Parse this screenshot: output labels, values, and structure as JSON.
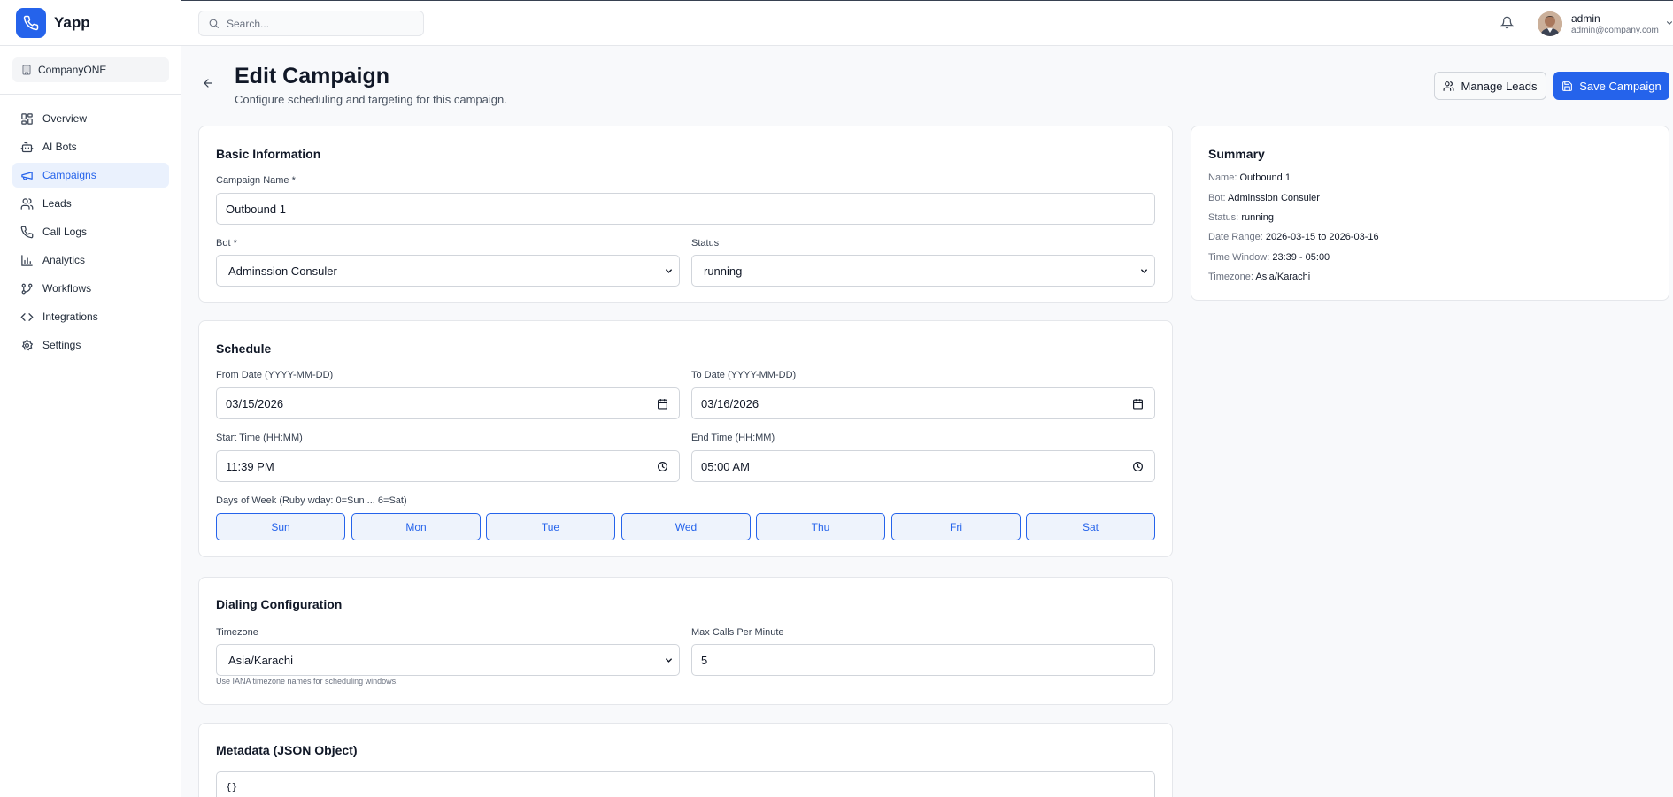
{
  "brand": {
    "name": "Yapp"
  },
  "company": {
    "name": "CompanyONE"
  },
  "nav": [
    {
      "label": "Overview",
      "icon": "grid-icon"
    },
    {
      "label": "AI Bots",
      "icon": "bot-icon"
    },
    {
      "label": "Campaigns",
      "icon": "megaphone-icon",
      "active": true
    },
    {
      "label": "Leads",
      "icon": "users-icon"
    },
    {
      "label": "Call Logs",
      "icon": "phone-icon"
    },
    {
      "label": "Analytics",
      "icon": "bar-chart-icon"
    },
    {
      "label": "Workflows",
      "icon": "workflow-icon"
    },
    {
      "label": "Integrations",
      "icon": "code-icon"
    },
    {
      "label": "Settings",
      "icon": "gear-icon"
    }
  ],
  "search": {
    "placeholder": "Search..."
  },
  "user": {
    "name": "admin",
    "email": "admin@company.com"
  },
  "header": {
    "title": "Edit Campaign",
    "subtitle": "Configure scheduling and targeting for this campaign.",
    "manage_leads_label": "Manage Leads",
    "save_label": "Save Campaign"
  },
  "basic": {
    "title": "Basic Information",
    "name_label": "Campaign Name *",
    "name_value": "Outbound 1",
    "bot_label": "Bot *",
    "bot_value": "Adminssion Consuler",
    "status_label": "Status",
    "status_value": "running"
  },
  "schedule": {
    "title": "Schedule",
    "from_label": "From Date (YYYY-MM-DD)",
    "from_value": "03/15/2026",
    "to_label": "To Date (YYYY-MM-DD)",
    "to_value": "03/16/2026",
    "start_label": "Start Time (HH:MM)",
    "start_value": "11:39 PM",
    "end_label": "End Time (HH:MM)",
    "end_value": "05:00 AM",
    "days_label": "Days of Week (Ruby wday: 0=Sun ... 6=Sat)",
    "days": [
      "Sun",
      "Mon",
      "Tue",
      "Wed",
      "Thu",
      "Fri",
      "Sat"
    ]
  },
  "dialing": {
    "title": "Dialing Configuration",
    "tz_label": "Timezone",
    "tz_value": "Asia/Karachi",
    "tz_hint": "Use IANA timezone names for scheduling windows.",
    "max_label": "Max Calls Per Minute",
    "max_value": "5"
  },
  "metadata": {
    "title": "Metadata (JSON Object)",
    "value": "{}"
  },
  "summary": {
    "title": "Summary",
    "name_key": "Name:",
    "name_val": "Outbound 1",
    "bot_key": "Bot:",
    "bot_val": "Adminssion Consuler",
    "status_key": "Status:",
    "status_val": "running",
    "range_key": "Date Range:",
    "range_val": "2026-03-15 to 2026-03-16",
    "window_key": "Time Window:",
    "window_val": "23:39 - 05:00",
    "tz_key": "Timezone:",
    "tz_val": "Asia/Karachi"
  },
  "colors": {
    "accent": "#2563eb",
    "active_bg": "#eaf1fd",
    "border": "#e5e7eb"
  }
}
